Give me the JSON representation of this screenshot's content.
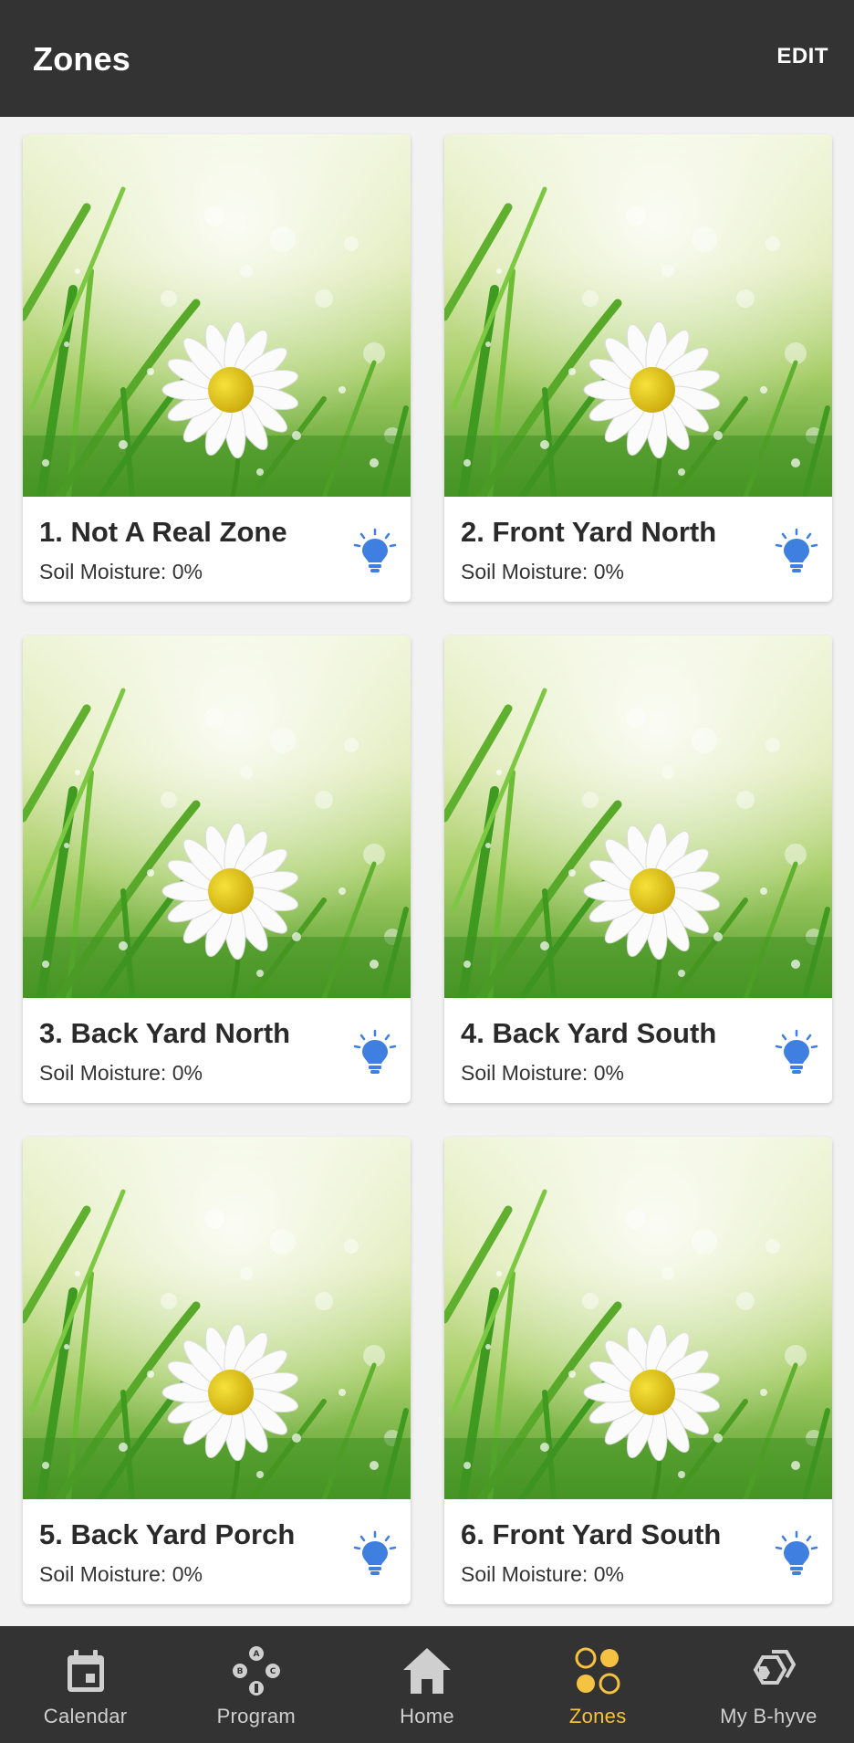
{
  "header": {
    "title": "Zones",
    "edit_label": "EDIT"
  },
  "zones": [
    {
      "name": "1. Not A Real Zone",
      "moisture": "Soil Moisture: 0%"
    },
    {
      "name": "2. Front Yard North",
      "moisture": "Soil Moisture: 0%"
    },
    {
      "name": "3. Back Yard North",
      "moisture": "Soil Moisture: 0%"
    },
    {
      "name": "4. Back Yard South",
      "moisture": "Soil Moisture: 0%"
    },
    {
      "name": "5. Back Yard Porch",
      "moisture": "Soil Moisture: 0%"
    },
    {
      "name": "6. Front Yard South",
      "moisture": "Soil Moisture: 0%"
    }
  ],
  "bottom_nav": [
    {
      "label": "Calendar",
      "icon": "calendar-icon"
    },
    {
      "label": "Program",
      "icon": "program-icon"
    },
    {
      "label": "Home",
      "icon": "home-icon"
    },
    {
      "label": "Zones",
      "icon": "zones-icon",
      "active": true
    },
    {
      "label": "My B-hyve",
      "icon": "hexagon-icon"
    }
  ],
  "colors": {
    "bar_background": "#333333",
    "accent": "#f5c242",
    "bulb_blue": "#3f7fe0"
  }
}
